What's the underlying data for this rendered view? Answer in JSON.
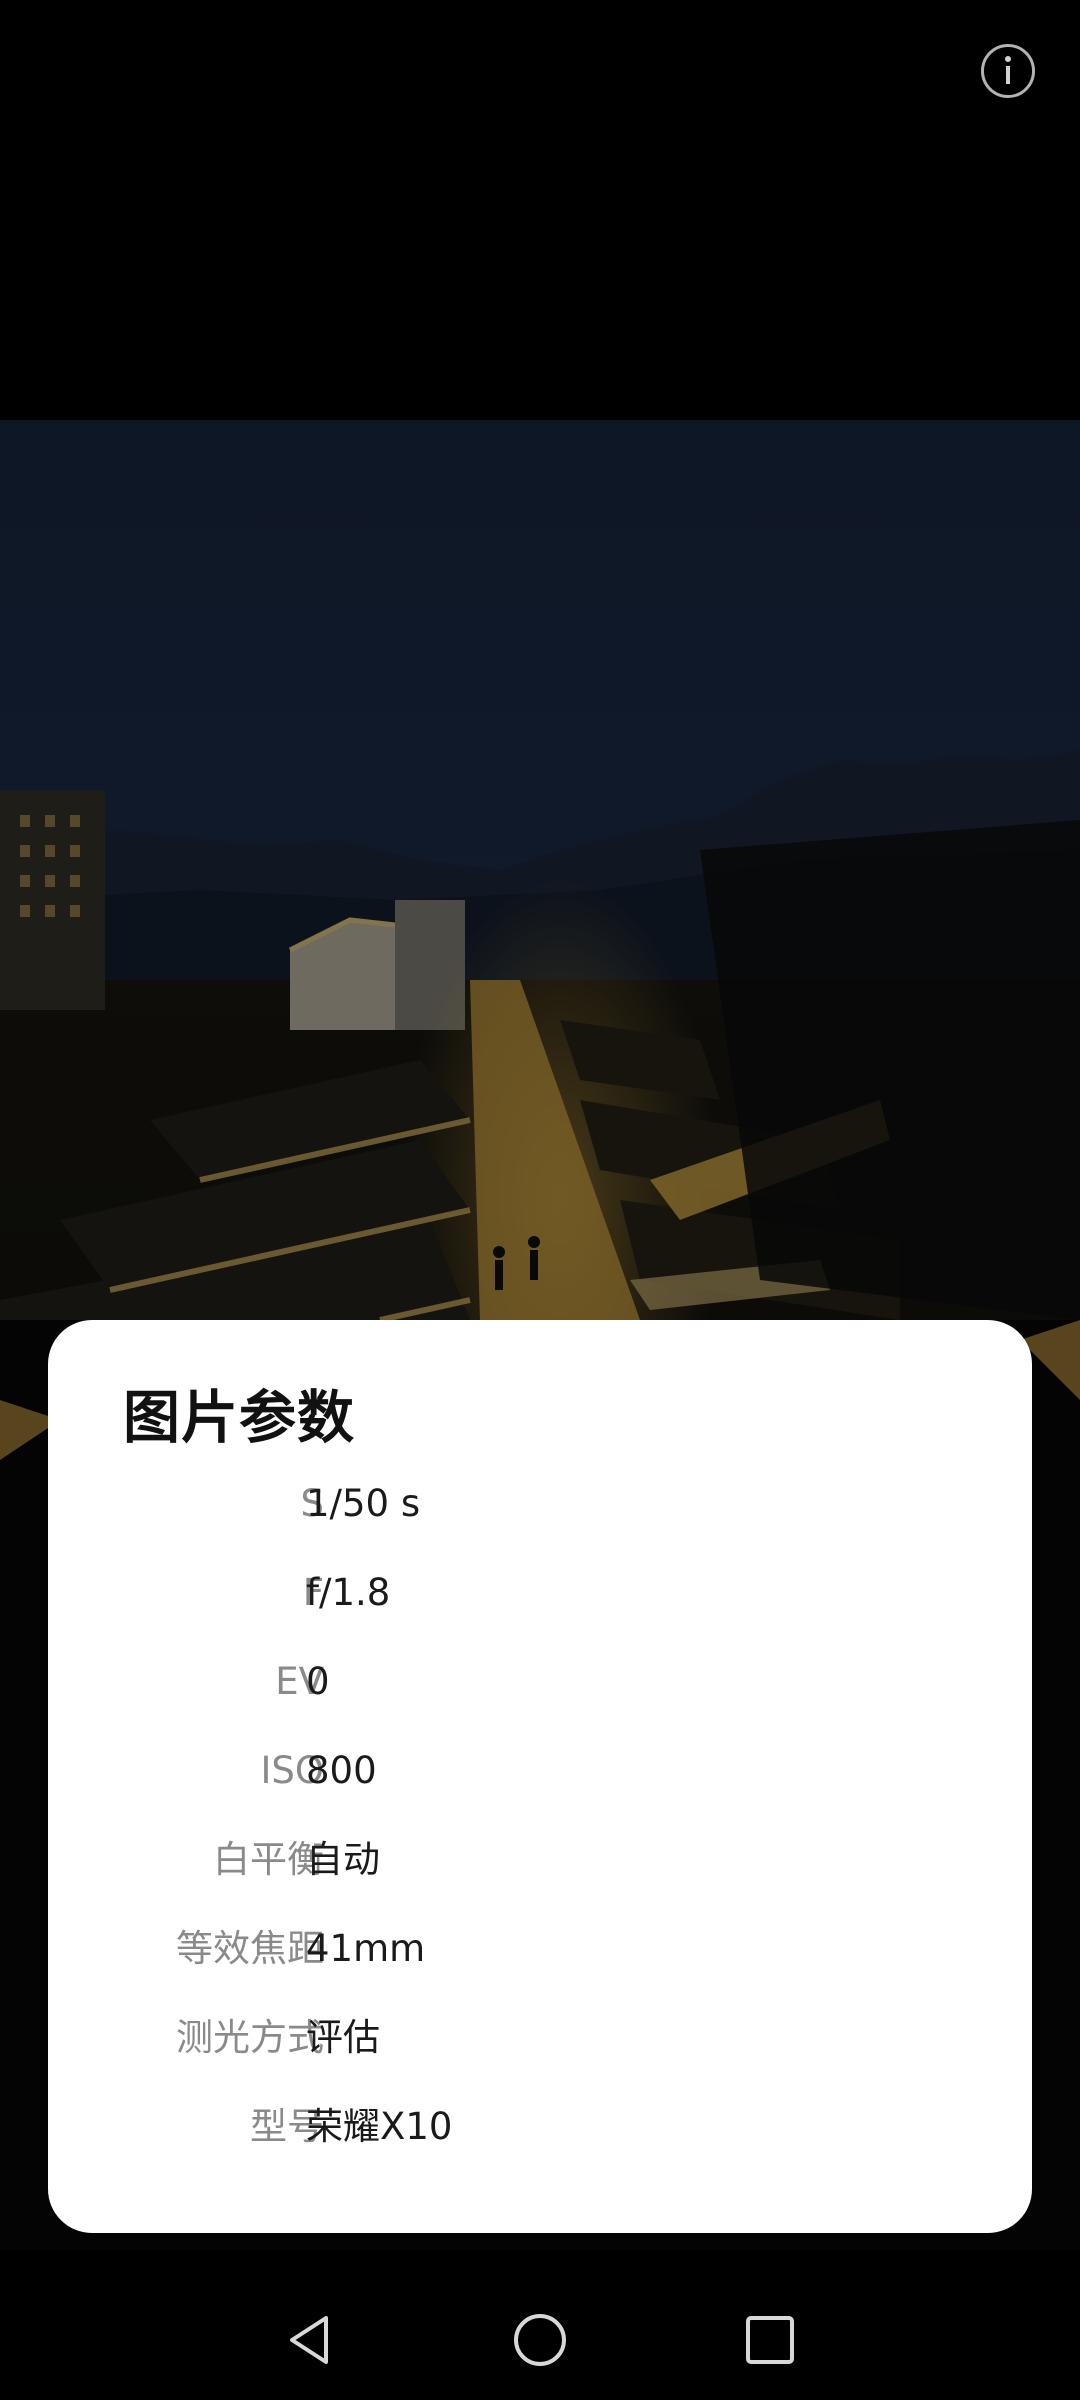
{
  "dialog": {
    "title": "图片参数",
    "params": [
      {
        "label": "S",
        "value": "1/50 s"
      },
      {
        "label": "F",
        "value": "f/1.8"
      },
      {
        "label": "EV",
        "value": "0"
      },
      {
        "label": "ISO",
        "value": "800"
      },
      {
        "label": "白平衡",
        "value": "自动"
      },
      {
        "label": "等效焦距",
        "value": "41mm"
      },
      {
        "label": "测光方式",
        "value": "评估"
      },
      {
        "label": "型号",
        "value": "荣耀X10"
      }
    ]
  },
  "icons": {
    "info": "info-icon",
    "back": "back-triangle-icon",
    "home": "home-circle-icon",
    "recents": "recents-square-icon"
  },
  "colors": {
    "background": "#000000",
    "dialog_bg": "#ffffff",
    "label": "#8a8a8a",
    "value": "#1a1a1a"
  }
}
